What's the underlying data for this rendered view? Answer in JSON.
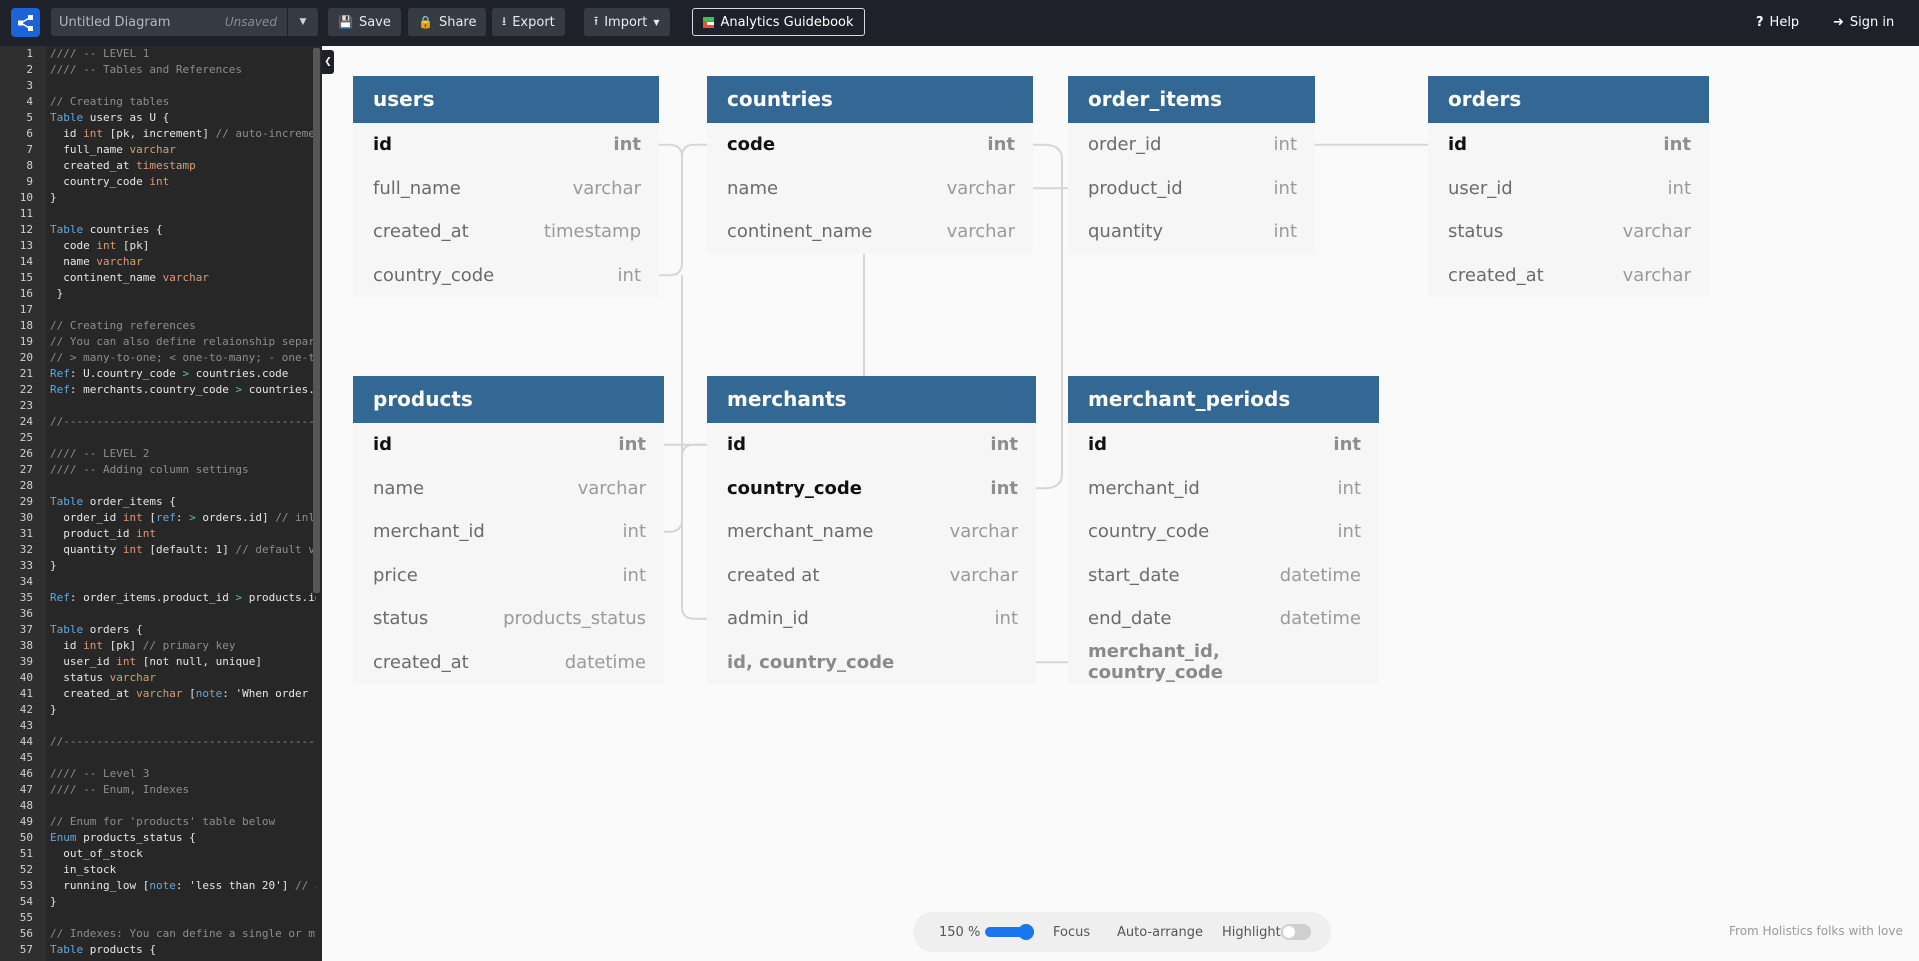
{
  "header": {
    "logo_icon": "share-nodes-icon",
    "diagram_title": "Untitled Diagram",
    "save_status": "Unsaved",
    "save_label": "Save",
    "share_label": "Share",
    "export_label": "Export",
    "import_label": "Import",
    "guidebook_label": "Analytics Guidebook",
    "help_label": "Help",
    "signin_label": "Sign in"
  },
  "editor": {
    "lines": [
      {
        "n": "1",
        "t": [
          [
            "c",
            "//// -- LEVEL 1"
          ]
        ]
      },
      {
        "n": "2",
        "t": [
          [
            "c",
            "//// -- Tables and References"
          ]
        ]
      },
      {
        "n": "3",
        "t": []
      },
      {
        "n": "4",
        "t": [
          [
            "c",
            "// Creating tables"
          ]
        ]
      },
      {
        "n": "5",
        "t": [
          [
            "k",
            "Table"
          ],
          [
            "p",
            " users as U {"
          ]
        ]
      },
      {
        "n": "6",
        "t": [
          [
            "p",
            "  id "
          ],
          [
            "t",
            "int"
          ],
          [
            "p",
            " [pk, increment] "
          ],
          [
            "c",
            "// auto-increment"
          ]
        ]
      },
      {
        "n": "7",
        "t": [
          [
            "p",
            "  full_name "
          ],
          [
            "t",
            "varchar"
          ]
        ]
      },
      {
        "n": "8",
        "t": [
          [
            "p",
            "  created_at "
          ],
          [
            "t",
            "timestamp"
          ]
        ]
      },
      {
        "n": "9",
        "t": [
          [
            "p",
            "  country_code "
          ],
          [
            "t",
            "int"
          ]
        ]
      },
      {
        "n": "10",
        "t": [
          [
            "p",
            "}"
          ]
        ]
      },
      {
        "n": "11",
        "t": []
      },
      {
        "n": "12",
        "t": [
          [
            "k",
            "Table"
          ],
          [
            "p",
            " countries {"
          ]
        ]
      },
      {
        "n": "13",
        "t": [
          [
            "p",
            "  code "
          ],
          [
            "t",
            "int"
          ],
          [
            "p",
            " [pk]"
          ]
        ]
      },
      {
        "n": "14",
        "t": [
          [
            "p",
            "  name "
          ],
          [
            "t",
            "varchar"
          ]
        ]
      },
      {
        "n": "15",
        "t": [
          [
            "p",
            "  continent_name "
          ],
          [
            "t",
            "varchar"
          ]
        ]
      },
      {
        "n": "16",
        "t": [
          [
            "p",
            " }"
          ]
        ]
      },
      {
        "n": "17",
        "t": []
      },
      {
        "n": "18",
        "t": [
          [
            "c",
            "// Creating references"
          ]
        ]
      },
      {
        "n": "19",
        "t": [
          [
            "c",
            "// You can also define relaionship separately"
          ]
        ]
      },
      {
        "n": "20",
        "t": [
          [
            "c",
            "// > many-to-one; < one-to-many; - one-to-one"
          ]
        ]
      },
      {
        "n": "21",
        "t": [
          [
            "k",
            "Ref"
          ],
          [
            "p",
            ": U.country_code "
          ],
          [
            "o",
            ">"
          ],
          [
            "p",
            " countries.code"
          ]
        ]
      },
      {
        "n": "22",
        "t": [
          [
            "k",
            "Ref"
          ],
          [
            "p",
            ": merchants.country_code "
          ],
          [
            "o",
            ">"
          ],
          [
            "p",
            " countries.code"
          ]
        ]
      },
      {
        "n": "23",
        "t": []
      },
      {
        "n": "24",
        "t": [
          [
            "c",
            "//----------------------------------------------"
          ]
        ]
      },
      {
        "n": "25",
        "t": []
      },
      {
        "n": "26",
        "t": [
          [
            "c",
            "//// -- LEVEL 2"
          ]
        ]
      },
      {
        "n": "27",
        "t": [
          [
            "c",
            "//// -- Adding column settings"
          ]
        ]
      },
      {
        "n": "28",
        "t": []
      },
      {
        "n": "29",
        "t": [
          [
            "k",
            "Table"
          ],
          [
            "p",
            " order_items {"
          ]
        ]
      },
      {
        "n": "30",
        "t": [
          [
            "p",
            "  order_id "
          ],
          [
            "t",
            "int"
          ],
          [
            "p",
            " ["
          ],
          [
            "k",
            "ref"
          ],
          [
            "p",
            ": "
          ],
          [
            "o",
            ">"
          ],
          [
            "p",
            " orders.id] "
          ],
          [
            "c",
            "// inline relationship"
          ]
        ]
      },
      {
        "n": "31",
        "t": [
          [
            "p",
            "  product_id "
          ],
          [
            "t",
            "int"
          ]
        ]
      },
      {
        "n": "32",
        "t": [
          [
            "p",
            "  quantity "
          ],
          [
            "t",
            "int"
          ],
          [
            "p",
            " [default: 1] "
          ],
          [
            "c",
            "// default value"
          ]
        ]
      },
      {
        "n": "33",
        "t": [
          [
            "p",
            "}"
          ]
        ]
      },
      {
        "n": "34",
        "t": []
      },
      {
        "n": "35",
        "t": [
          [
            "k",
            "Ref"
          ],
          [
            "p",
            ": order_items.product_id "
          ],
          [
            "o",
            ">"
          ],
          [
            "p",
            " products.id"
          ]
        ]
      },
      {
        "n": "36",
        "t": []
      },
      {
        "n": "37",
        "t": [
          [
            "k",
            "Table"
          ],
          [
            "p",
            " orders {"
          ]
        ]
      },
      {
        "n": "38",
        "t": [
          [
            "p",
            "  id "
          ],
          [
            "t",
            "int"
          ],
          [
            "p",
            " [pk] "
          ],
          [
            "c",
            "// primary key"
          ]
        ]
      },
      {
        "n": "39",
        "t": [
          [
            "p",
            "  user_id "
          ],
          [
            "t",
            "int"
          ],
          [
            "p",
            " [not null, unique]"
          ]
        ]
      },
      {
        "n": "40",
        "t": [
          [
            "p",
            "  status "
          ],
          [
            "t",
            "varchar"
          ]
        ]
      },
      {
        "n": "41",
        "t": [
          [
            "p",
            "  created_at "
          ],
          [
            "t",
            "varchar"
          ],
          [
            "p",
            " ["
          ],
          [
            "k",
            "note"
          ],
          [
            "p",
            ": 'When order created']"
          ]
        ]
      },
      {
        "n": "42",
        "t": [
          [
            "p",
            "}"
          ]
        ]
      },
      {
        "n": "43",
        "t": []
      },
      {
        "n": "44",
        "t": [
          [
            "c",
            "//----------------------------------------------"
          ]
        ]
      },
      {
        "n": "45",
        "t": []
      },
      {
        "n": "46",
        "t": [
          [
            "c",
            "//// -- Level 3"
          ]
        ]
      },
      {
        "n": "47",
        "t": [
          [
            "c",
            "//// -- Enum, Indexes"
          ]
        ]
      },
      {
        "n": "48",
        "t": []
      },
      {
        "n": "49",
        "t": [
          [
            "c",
            "// Enum for 'products' table below"
          ]
        ]
      },
      {
        "n": "50",
        "t": [
          [
            "k",
            "Enum"
          ],
          [
            "p",
            " products_status {"
          ]
        ]
      },
      {
        "n": "51",
        "t": [
          [
            "p",
            "  out_of_stock"
          ]
        ]
      },
      {
        "n": "52",
        "t": [
          [
            "p",
            "  in_stock"
          ]
        ]
      },
      {
        "n": "53",
        "t": [
          [
            "p",
            "  running_low ["
          ],
          [
            "k",
            "note"
          ],
          [
            "p",
            ": 'less than 20'] "
          ],
          [
            "c",
            "// add column note"
          ]
        ]
      },
      {
        "n": "54",
        "t": [
          [
            "p",
            "}"
          ]
        ]
      },
      {
        "n": "55",
        "t": []
      },
      {
        "n": "56",
        "t": [
          [
            "c",
            "// Indexes: You can define a single or multi-column index"
          ]
        ]
      },
      {
        "n": "57",
        "t": [
          [
            "k",
            "Table"
          ],
          [
            "p",
            " products {"
          ]
        ]
      }
    ]
  },
  "diagram": {
    "tables": [
      {
        "name": "users",
        "fields": [
          {
            "name": "id",
            "type": "int",
            "pk": true
          },
          {
            "name": "full_name",
            "type": "varchar"
          },
          {
            "name": "created_at",
            "type": "timestamp"
          },
          {
            "name": "country_code",
            "type": "int"
          }
        ]
      },
      {
        "name": "countries",
        "fields": [
          {
            "name": "code",
            "type": "int",
            "pk": true
          },
          {
            "name": "name",
            "type": "varchar"
          },
          {
            "name": "continent_name",
            "type": "varchar"
          }
        ]
      },
      {
        "name": "order_items",
        "fields": [
          {
            "name": "order_id",
            "type": "int"
          },
          {
            "name": "product_id",
            "type": "int"
          },
          {
            "name": "quantity",
            "type": "int"
          }
        ]
      },
      {
        "name": "orders",
        "fields": [
          {
            "name": "id",
            "type": "int",
            "pk": true
          },
          {
            "name": "user_id",
            "type": "int"
          },
          {
            "name": "status",
            "type": "varchar"
          },
          {
            "name": "created_at",
            "type": "varchar"
          }
        ]
      },
      {
        "name": "products",
        "fields": [
          {
            "name": "id",
            "type": "int",
            "pk": true
          },
          {
            "name": "name",
            "type": "varchar"
          },
          {
            "name": "merchant_id",
            "type": "int"
          },
          {
            "name": "price",
            "type": "int"
          },
          {
            "name": "status",
            "type": "products_status"
          },
          {
            "name": "created_at",
            "type": "datetime"
          }
        ]
      },
      {
        "name": "merchants",
        "fields": [
          {
            "name": "id",
            "type": "int",
            "pk": true
          },
          {
            "name": "country_code",
            "type": "int",
            "pk": true
          },
          {
            "name": "merchant_name",
            "type": "varchar"
          },
          {
            "name": "created at",
            "type": "varchar"
          },
          {
            "name": "admin_id",
            "type": "int"
          },
          {
            "name": "id, country_code",
            "type": "",
            "index": true
          }
        ]
      },
      {
        "name": "merchant_periods",
        "fields": [
          {
            "name": "id",
            "type": "int",
            "pk": true
          },
          {
            "name": "merchant_id",
            "type": "int"
          },
          {
            "name": "country_code",
            "type": "int"
          },
          {
            "name": "start_date",
            "type": "datetime"
          },
          {
            "name": "end_date",
            "type": "datetime"
          },
          {
            "name": "merchant_id, country_code",
            "type": "",
            "index": true
          }
        ]
      }
    ],
    "header_color": "#326893"
  },
  "bottom_toolbar": {
    "zoom_label": "150 %",
    "zoom_percent": 150,
    "focus_label": "Focus",
    "auto_arrange_label": "Auto-arrange",
    "highlight_label": "Highlight",
    "highlight_on": false
  },
  "footer_note": "From Holistics folks with love"
}
